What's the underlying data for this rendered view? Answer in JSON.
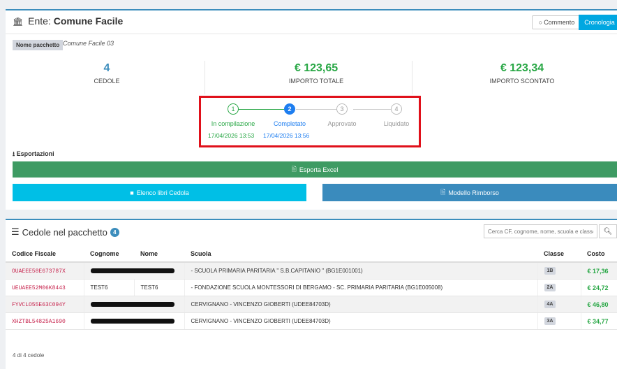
{
  "header": {
    "entity_prefix": "Ente:",
    "entity_name": "Comune Facile",
    "comment_label": "Commento",
    "history_label": "Cronologia"
  },
  "package": {
    "name_label": "Nome pacchetto",
    "name_value": "Comune Facile 03"
  },
  "stats": {
    "cedole_value": "4",
    "cedole_label": "CEDOLE",
    "importo_totale_value": "€ 123,65",
    "importo_totale_label": "IMPORTO TOTALE",
    "importo_scontato_value": "€ 123,34",
    "importo_scontato_label": "IMPORTO SCONTATO"
  },
  "steps": [
    {
      "number": "1",
      "label": "In compilazione",
      "date": "17/04/2026 13:53",
      "state": "done"
    },
    {
      "number": "2",
      "label": "Completato",
      "date": "17/04/2026 13:56",
      "state": "current"
    },
    {
      "number": "3",
      "label": "Approvato",
      "date": "",
      "state": "pending"
    },
    {
      "number": "4",
      "label": "Liquidato",
      "date": "",
      "state": "pending"
    }
  ],
  "exports": {
    "title": "Esportazioni",
    "excel_label": "Esporta Excel",
    "elenco_label": "Elenco libri Cedola",
    "modello_label": "Modello Rimborso"
  },
  "cedole": {
    "title": "Cedole nel pacchetto",
    "count_badge": "4",
    "search_placeholder": "Cerca CF, cognome, nome, scuola e classe",
    "columns": [
      "Codice Fiscale",
      "Cognome",
      "Nome",
      "Scuola",
      "Classe",
      "Costo"
    ],
    "rows": [
      {
        "cf": "OUAEEE58E673787X",
        "cognome": "",
        "nome": "",
        "redacted": true,
        "scuola": "- SCUOLA PRIMARIA PARITARIA \" S.B.CAPITANIO \" (BG1E001001)",
        "classe": "1B",
        "costo": "€ 17,36"
      },
      {
        "cf": "UEUAEE52M06K8443",
        "cognome": "TEST6",
        "nome": "TEST6",
        "redacted": false,
        "scuola": "- FONDAZIONE SCUOLA MONTESSORI DI BERGAMO - SC. PRIMARIA PARITARIA (BG1E005008)",
        "classe": "2A",
        "costo": "€ 24,72"
      },
      {
        "cf": "FYVCLO55E63C094Y",
        "cognome": "",
        "nome": "",
        "redacted": true,
        "scuola": "CERVIGNANO - VINCENZO GIOBERTI (UDEE84703D)",
        "classe": "4A",
        "costo": "€ 46,80"
      },
      {
        "cf": "XHZTBL54825A1690",
        "cognome": "",
        "nome": "",
        "redacted": true,
        "scuola": "CERVIGNANO - VINCENZO GIOBERTI (UDEE84703D)",
        "classe": "3A",
        "costo": "€ 34,77"
      }
    ],
    "footer": "4 di 4 cedole"
  },
  "colors": {
    "accent": "#3c8dbc",
    "history_button": "#00a7e1",
    "excel_button": "#3e9b63",
    "elenco_button": "#00bfe6",
    "modello_button": "#3a8bbd",
    "highlight_box": "#e0101a",
    "step_done": "#28a745",
    "step_current": "#1e7ef0",
    "cost_text": "#28a745",
    "cf_text": "#c7254e"
  }
}
